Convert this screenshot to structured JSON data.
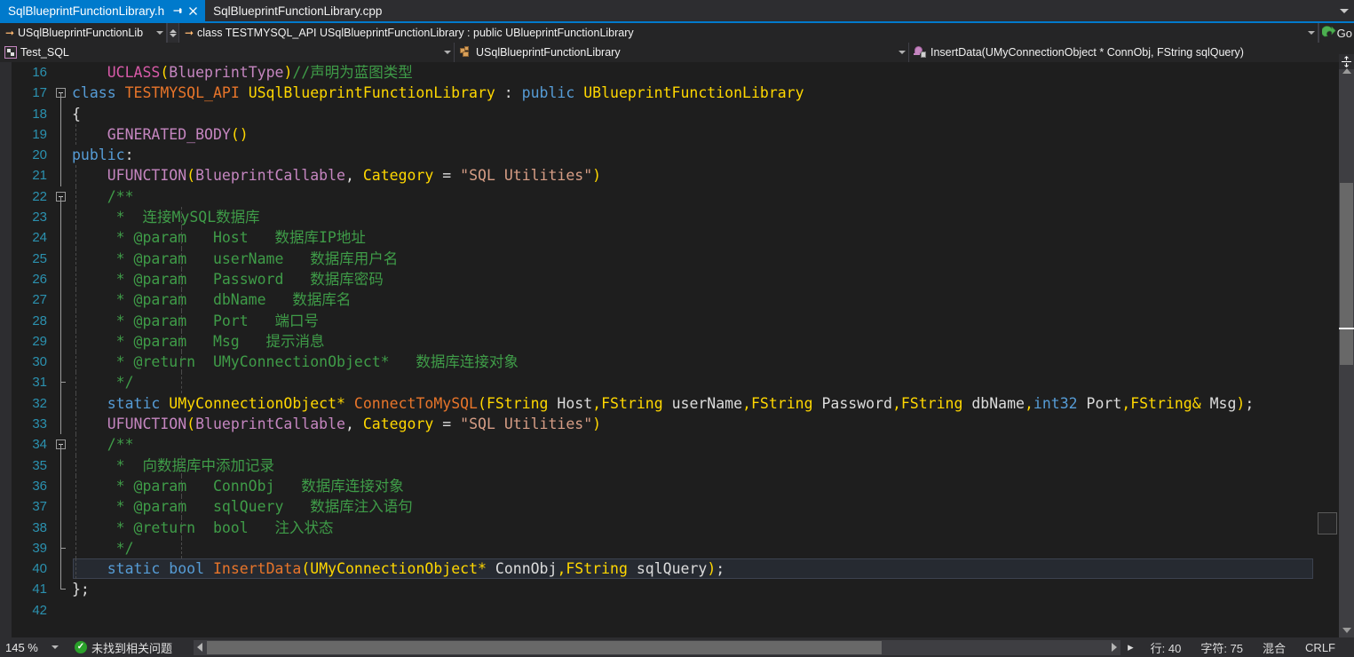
{
  "window": {
    "accent_color": "#007acc",
    "background": "#1e1e1e",
    "chrome_background": "#2d2d30"
  },
  "tabstrip": {
    "tabs": [
      {
        "label": "SqlBlueprintFunctionLibrary.h",
        "active": true,
        "pin_icon": "pin-icon",
        "close_icon": "close-icon"
      },
      {
        "label": "SqlBlueprintFunctionLibrary.cpp",
        "active": false
      }
    ],
    "overflow_icon": "chevron-down-icon"
  },
  "navbar": {
    "scope_combo": {
      "value": "USqlBlueprintFunctionLib",
      "arrow_icon": "arrow-right-icon",
      "caret_icon": "chevron-down-icon"
    },
    "spinner": {
      "up_icon": "chevron-up-icon",
      "down_icon": "chevron-down-icon"
    },
    "signature_combo": {
      "value": "class TESTMYSQL_API USqlBlueprintFunctionLibrary : public UBlueprintFunctionLibrary",
      "arrow_icon": "arrow-right-icon",
      "caret_icon": "chevron-down-icon"
    },
    "goto": {
      "label": "Go",
      "icon": "green-go-arrow-icon"
    }
  },
  "navbar2": {
    "project": {
      "value": "Test_SQL",
      "icon": "project-icon",
      "caret_icon": "chevron-down-icon"
    },
    "member": {
      "value": "USqlBlueprintFunctionLibrary",
      "icon": "class-icon",
      "caret_icon": "chevron-down-icon"
    },
    "function": {
      "value": "InsertData(UMyConnectionObject * ConnObj, FString sqlQuery)",
      "icon": "method-icon"
    }
  },
  "editor": {
    "current_line": 40,
    "first_line": 16,
    "lines": [
      {
        "n": 16,
        "fold": "none",
        "guides": [],
        "tokens": [
          {
            "t": "    ",
            "c": "plain"
          },
          {
            "t": "UCLASS",
            "c": "macro"
          },
          {
            "t": "(",
            "c": "paren"
          },
          {
            "t": "BlueprintType",
            "c": "macro2"
          },
          {
            "t": ")",
            "c": "paren"
          },
          {
            "t": "//声明为蓝图类型",
            "c": "comment"
          }
        ]
      },
      {
        "n": 17,
        "fold": "box",
        "guides": [],
        "tokens": [
          {
            "t": "class",
            "c": "key"
          },
          {
            "t": " ",
            "c": "plain"
          },
          {
            "t": "TESTMYSQL_API",
            "c": "func"
          },
          {
            "t": " ",
            "c": "plain"
          },
          {
            "t": "USqlBlueprintFunctionLibrary",
            "c": "typeb"
          },
          {
            "t": " : ",
            "c": "plain"
          },
          {
            "t": "public",
            "c": "key"
          },
          {
            "t": " ",
            "c": "plain"
          },
          {
            "t": "UBlueprintFunctionLibrary",
            "c": "typeb"
          }
        ]
      },
      {
        "n": 18,
        "fold": "line",
        "guides": [],
        "tokens": [
          {
            "t": "{",
            "c": "plain"
          }
        ]
      },
      {
        "n": 19,
        "fold": "line",
        "guides": [
          20
        ],
        "tokens": [
          {
            "t": "    ",
            "c": "plain"
          },
          {
            "t": "GENERATED_BODY",
            "c": "macro2"
          },
          {
            "t": "()",
            "c": "paren"
          }
        ]
      },
      {
        "n": 20,
        "fold": "line",
        "guides": [],
        "tokens": [
          {
            "t": "public",
            "c": "key"
          },
          {
            "t": ":",
            "c": "plain"
          }
        ]
      },
      {
        "n": 21,
        "fold": "line",
        "guides": [
          20
        ],
        "tokens": [
          {
            "t": "    ",
            "c": "plain"
          },
          {
            "t": "UFUNCTION",
            "c": "macro2"
          },
          {
            "t": "(",
            "c": "paren"
          },
          {
            "t": "BlueprintCallable",
            "c": "macro2"
          },
          {
            "t": ", ",
            "c": "plain"
          },
          {
            "t": "Category",
            "c": "param"
          },
          {
            "t": " = ",
            "c": "plain"
          },
          {
            "t": "\"SQL Utilities\"",
            "c": "string"
          },
          {
            "t": ")",
            "c": "paren"
          }
        ]
      },
      {
        "n": 22,
        "fold": "box2",
        "guides": [
          20
        ],
        "tokens": [
          {
            "t": "    ",
            "c": "plain"
          },
          {
            "t": "/**",
            "c": "comment"
          }
        ]
      },
      {
        "n": 23,
        "fold": "line",
        "guides": [
          20,
          32
        ],
        "tokens": [
          {
            "t": "     *  连接MySQL数据库",
            "c": "comment"
          }
        ]
      },
      {
        "n": 24,
        "fold": "line",
        "guides": [
          20,
          32
        ],
        "tokens": [
          {
            "t": "     * @param   Host   数据库IP地址",
            "c": "comment"
          }
        ]
      },
      {
        "n": 25,
        "fold": "line",
        "guides": [
          20,
          32
        ],
        "tokens": [
          {
            "t": "     * @param   userName   数据库用户名",
            "c": "comment"
          }
        ]
      },
      {
        "n": 26,
        "fold": "line",
        "guides": [
          20,
          32
        ],
        "tokens": [
          {
            "t": "     * @param   Password   数据库密码",
            "c": "comment"
          }
        ]
      },
      {
        "n": 27,
        "fold": "line",
        "guides": [
          20,
          32
        ],
        "tokens": [
          {
            "t": "     * @param   dbName   数据库名",
            "c": "comment"
          }
        ]
      },
      {
        "n": 28,
        "fold": "line",
        "guides": [
          20,
          32
        ],
        "tokens": [
          {
            "t": "     * @param   Port   端口号",
            "c": "comment"
          }
        ]
      },
      {
        "n": 29,
        "fold": "line",
        "guides": [
          20,
          32
        ],
        "tokens": [
          {
            "t": "     * @param   Msg   提示消息",
            "c": "comment"
          }
        ]
      },
      {
        "n": 30,
        "fold": "line",
        "guides": [
          20,
          32
        ],
        "tokens": [
          {
            "t": "     * @return  UMyConnectionObject*   数据库连接对象",
            "c": "comment"
          }
        ]
      },
      {
        "n": 31,
        "fold": "elbow",
        "guides": [
          20,
          32
        ],
        "tokens": [
          {
            "t": "     */",
            "c": "comment"
          }
        ]
      },
      {
        "n": 32,
        "fold": "line",
        "guides": [
          20
        ],
        "tokens": [
          {
            "t": "    ",
            "c": "plain"
          },
          {
            "t": "static",
            "c": "key"
          },
          {
            "t": " ",
            "c": "plain"
          },
          {
            "t": "UMyConnectionObject*",
            "c": "typeb"
          },
          {
            "t": " ",
            "c": "plain"
          },
          {
            "t": "ConnectToMySQL",
            "c": "func"
          },
          {
            "t": "(",
            "c": "paren"
          },
          {
            "t": "FString",
            "c": "typeb"
          },
          {
            "t": " Host",
            "c": "ident"
          },
          {
            "t": ",",
            "c": "paren"
          },
          {
            "t": "FString",
            "c": "typeb"
          },
          {
            "t": " userName",
            "c": "ident"
          },
          {
            "t": ",",
            "c": "paren"
          },
          {
            "t": "FString",
            "c": "typeb"
          },
          {
            "t": " Password",
            "c": "ident"
          },
          {
            "t": ",",
            "c": "paren"
          },
          {
            "t": "FString",
            "c": "typeb"
          },
          {
            "t": " dbName",
            "c": "ident"
          },
          {
            "t": ",",
            "c": "paren"
          },
          {
            "t": "int32",
            "c": "key"
          },
          {
            "t": " Port",
            "c": "ident"
          },
          {
            "t": ",",
            "c": "paren"
          },
          {
            "t": "FString&",
            "c": "typeb"
          },
          {
            "t": " Msg",
            "c": "ident"
          },
          {
            "t": ")",
            "c": "paren"
          },
          {
            "t": ";",
            "c": "plain"
          }
        ]
      },
      {
        "n": 33,
        "fold": "line",
        "guides": [
          20
        ],
        "tokens": [
          {
            "t": "    ",
            "c": "plain"
          },
          {
            "t": "UFUNCTION",
            "c": "macro2"
          },
          {
            "t": "(",
            "c": "paren"
          },
          {
            "t": "BlueprintCallable",
            "c": "macro2"
          },
          {
            "t": ", ",
            "c": "plain"
          },
          {
            "t": "Category",
            "c": "param"
          },
          {
            "t": " = ",
            "c": "plain"
          },
          {
            "t": "\"SQL Utilities\"",
            "c": "string"
          },
          {
            "t": ")",
            "c": "paren"
          }
        ]
      },
      {
        "n": 34,
        "fold": "box2",
        "guides": [
          20
        ],
        "tokens": [
          {
            "t": "    ",
            "c": "plain"
          },
          {
            "t": "/**",
            "c": "comment"
          }
        ]
      },
      {
        "n": 35,
        "fold": "line",
        "guides": [
          20,
          32
        ],
        "tokens": [
          {
            "t": "     *  向数据库中添加记录",
            "c": "comment"
          }
        ]
      },
      {
        "n": 36,
        "fold": "line",
        "guides": [
          20,
          32
        ],
        "tokens": [
          {
            "t": "     * @param   ConnObj   数据库连接对象",
            "c": "comment"
          }
        ]
      },
      {
        "n": 37,
        "fold": "line",
        "guides": [
          20,
          32
        ],
        "tokens": [
          {
            "t": "     * @param   sqlQuery   数据库注入语句",
            "c": "comment"
          }
        ]
      },
      {
        "n": 38,
        "fold": "line",
        "guides": [
          20,
          32
        ],
        "tokens": [
          {
            "t": "     * @return  bool   注入状态",
            "c": "comment"
          }
        ]
      },
      {
        "n": 39,
        "fold": "elbow",
        "guides": [
          20,
          32
        ],
        "tokens": [
          {
            "t": "     */",
            "c": "comment"
          }
        ]
      },
      {
        "n": 40,
        "fold": "line",
        "guides": [
          20
        ],
        "current": true,
        "tokens": [
          {
            "t": "    ",
            "c": "plain"
          },
          {
            "t": "static",
            "c": "key"
          },
          {
            "t": " ",
            "c": "plain"
          },
          {
            "t": "bool",
            "c": "key"
          },
          {
            "t": " ",
            "c": "plain"
          },
          {
            "t": "InsertData",
            "c": "func"
          },
          {
            "t": "(",
            "c": "paren"
          },
          {
            "t": "UMyConnectionObject*",
            "c": "typeb"
          },
          {
            "t": " ConnObj",
            "c": "ident"
          },
          {
            "t": ",",
            "c": "paren"
          },
          {
            "t": "FString",
            "c": "typeb"
          },
          {
            "t": " sqlQuery",
            "c": "ident"
          },
          {
            "t": ")",
            "c": "paren"
          },
          {
            "t": ";",
            "c": "plain"
          }
        ]
      },
      {
        "n": 41,
        "fold": "endline",
        "guides": [],
        "tokens": [
          {
            "t": "};",
            "c": "plain"
          }
        ]
      },
      {
        "n": 42,
        "fold": "none",
        "guides": [],
        "tokens": [
          {
            "t": "",
            "c": "plain"
          }
        ]
      }
    ]
  },
  "scrollbars": {
    "vertical": {
      "split_icon": "split-pane-icon",
      "up_icon": "scroll-up-arrow-icon",
      "down_icon": "scroll-down-arrow-icon"
    },
    "horizontal": {
      "left_icon": "scroll-left-arrow-icon",
      "right_icon": "scroll-right-arrow-icon"
    }
  },
  "statusbar": {
    "zoom": "145 %",
    "zoom_caret_icon": "chevron-down-icon",
    "issue_icon": "check-circle-icon",
    "issue_text": "未找到相关问题",
    "expand_icon": "triangle-right-icon",
    "line_label": "行: 40",
    "char_label": "字符: 75",
    "encoding_label": "混合",
    "eol_label": "CRLF"
  }
}
